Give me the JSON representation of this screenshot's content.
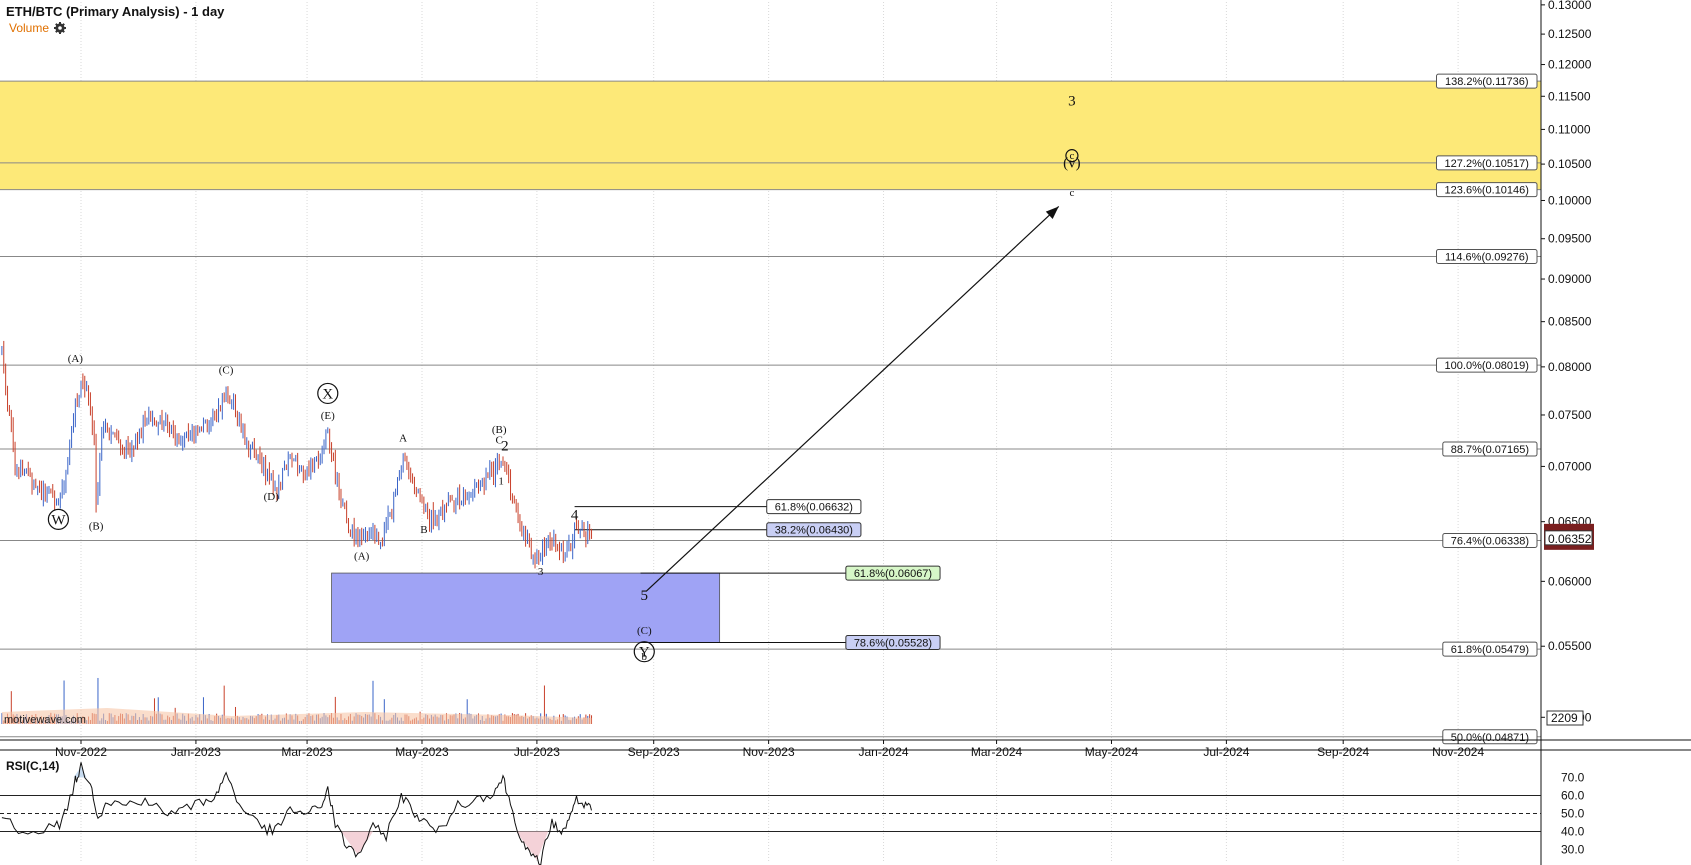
{
  "header": {
    "title": "ETH/BTC (Primary Analysis) - 1 day",
    "volume_label": "Volume",
    "watermark": "motivewave.com",
    "gear_icon": "gear-icon"
  },
  "colors": {
    "up": "#3a64c8",
    "down": "#c8402a",
    "target_zone": "#fde978",
    "support_zone": "#9fa3f5",
    "fib_green": "#d7f7c8",
    "fib_blue": "#c9cff5",
    "volume_area": "#f7c7a8",
    "rsi_fill": "#f4d2d8",
    "price_tag": "#7a1f1f",
    "wave3_red": "#e31e1e"
  },
  "chart_data": {
    "type": "candlestick",
    "title": "ETH/BTC (Primary Analysis) - 1 day",
    "y_axis": {
      "ticks": [
        "0.05000",
        "0.05500",
        "0.06000",
        "0.06500",
        "0.07000",
        "0.07500",
        "0.08000",
        "0.08500",
        "0.09000",
        "0.09500",
        "0.10000",
        "0.10500",
        "0.11000",
        "0.11500",
        "0.12000",
        "0.12500",
        "0.13000"
      ],
      "range": [
        0.0485,
        0.1305
      ],
      "scale": "log"
    },
    "x_axis": {
      "ticks": [
        "Nov-2022",
        "Jan-2023",
        "Mar-2023",
        "May-2023",
        "Jul-2023",
        "Sep-2023",
        "Nov-2023",
        "Jan-2024",
        "Mar-2024",
        "May-2024",
        "Jul-2024",
        "Sep-2024",
        "Nov-2024"
      ],
      "range": [
        "2022-09-19",
        "2024-12-15"
      ]
    },
    "price_path": [
      [
        "2022-09-20",
        0.0818
      ],
      [
        "2022-09-27",
        0.07
      ],
      [
        "2022-10-05",
        0.069
      ],
      [
        "2022-10-12",
        0.0675
      ],
      [
        "2022-10-20",
        0.0668
      ],
      [
        "2022-10-25",
        0.07
      ],
      [
        "2022-10-29",
        0.076
      ],
      [
        "2022-11-01",
        0.0787
      ],
      [
        "2022-11-05",
        0.077
      ],
      [
        "2022-11-08",
        0.072
      ],
      [
        "2022-11-09",
        0.066
      ],
      [
        "2022-11-12",
        0.074
      ],
      [
        "2022-11-20",
        0.0725
      ],
      [
        "2022-11-28",
        0.071
      ],
      [
        "2022-12-05",
        0.0745
      ],
      [
        "2022-12-12",
        0.0745
      ],
      [
        "2022-12-20",
        0.0728
      ],
      [
        "2022-12-28",
        0.073
      ],
      [
        "2023-01-05",
        0.074
      ],
      [
        "2023-01-12",
        0.075
      ],
      [
        "2023-01-17",
        0.0778
      ],
      [
        "2023-01-22",
        0.0755
      ],
      [
        "2023-01-29",
        0.072
      ],
      [
        "2023-02-05",
        0.07
      ],
      [
        "2023-02-13",
        0.068
      ],
      [
        "2023-02-20",
        0.0705
      ],
      [
        "2023-02-28",
        0.0695
      ],
      [
        "2023-03-07",
        0.0705
      ],
      [
        "2023-03-12",
        0.0735
      ],
      [
        "2023-03-16",
        0.069
      ],
      [
        "2023-03-22",
        0.065
      ],
      [
        "2023-03-28",
        0.0635
      ],
      [
        "2023-04-05",
        0.064
      ],
      [
        "2023-04-10",
        0.063
      ],
      [
        "2023-04-16",
        0.067
      ],
      [
        "2023-04-22",
        0.071
      ],
      [
        "2023-04-27",
        0.068
      ],
      [
        "2023-05-02",
        0.066
      ],
      [
        "2023-05-08",
        0.065
      ],
      [
        "2023-05-15",
        0.0665
      ],
      [
        "2023-05-25",
        0.0675
      ],
      [
        "2023-06-03",
        0.0685
      ],
      [
        "2023-06-10",
        0.07
      ],
      [
        "2023-06-13",
        0.0705
      ],
      [
        "2023-06-17",
        0.068
      ],
      [
        "2023-06-22",
        0.065
      ],
      [
        "2023-06-28",
        0.0625
      ],
      [
        "2023-07-02",
        0.0617
      ],
      [
        "2023-07-08",
        0.0635
      ],
      [
        "2023-07-13",
        0.0625
      ],
      [
        "2023-07-18",
        0.0625
      ],
      [
        "2023-07-21",
        0.0642
      ],
      [
        "2023-07-25",
        0.064
      ],
      [
        "2023-07-30",
        0.0638
      ]
    ],
    "current_price": "0.06352",
    "fib_levels_right": [
      {
        "label": "138.2%(0.11736)",
        "value": 0.11736
      },
      {
        "label": "127.2%(0.10517)",
        "value": 0.10517
      },
      {
        "label": "123.6%(0.10146)",
        "value": 0.10146
      },
      {
        "label": "114.6%(0.09276)",
        "value": 0.09276
      },
      {
        "label": "100.0%(0.08019)",
        "value": 0.08019
      },
      {
        "label": "88.7%(0.07165)",
        "value": 0.07165
      },
      {
        "label": "76.4%(0.06338)",
        "value": 0.06338
      },
      {
        "label": "61.8%(0.05479)",
        "value": 0.05479
      },
      {
        "label": "50.0%(0.04871)",
        "value": 0.04871
      }
    ],
    "fib_levels_mid": [
      {
        "label": "61.8%(0.06632)",
        "value": 0.06632,
        "start": "2023-07-21",
        "end": "2023-10-31"
      },
      {
        "label": "38.2%(0.06430)",
        "value": 0.0643,
        "start": "2023-07-21",
        "end": "2023-10-31"
      },
      {
        "label": "61.8%(0.06067)",
        "value": 0.06067,
        "start": "2023-08-25",
        "end": "2023-12-12"
      },
      {
        "label": "78.6%(0.05528)",
        "value": 0.05528,
        "start": "2023-08-25",
        "end": "2023-12-12"
      }
    ],
    "zones": [
      {
        "name": "target",
        "from": 0.10146,
        "to": 0.11736,
        "start": "2022-09-19",
        "end": "2024-12-15"
      },
      {
        "name": "support",
        "from": 0.05528,
        "to": 0.06067,
        "start": "2023-03-14",
        "end": "2023-10-06"
      }
    ],
    "arrow": {
      "from": [
        "2023-08-28",
        0.0592
      ],
      "to": [
        "2024-04-03",
        0.0992
      ]
    },
    "wave_labels": [
      {
        "t": "(A)",
        "d": "2022-10-29",
        "v": 0.0805,
        "c": "#111"
      },
      {
        "t": "(B)",
        "d": "2022-11-09",
        "v": 0.0643,
        "c": "#111"
      },
      {
        "t": "(C)",
        "d": "2023-01-17",
        "v": 0.0793,
        "c": "#111"
      },
      {
        "t": "(D)",
        "d": "2023-02-10",
        "v": 0.0669,
        "c": "#111"
      },
      {
        "t": "(E)",
        "d": "2023-03-12",
        "v": 0.0746,
        "c": "#111"
      },
      {
        "t": "(A)",
        "d": "2023-03-30",
        "v": 0.0618,
        "c": "#111"
      },
      {
        "t": "A",
        "d": "2023-04-21",
        "v": 0.0724,
        "c": "#111"
      },
      {
        "t": "B",
        "d": "2023-05-02",
        "v": 0.064,
        "c": "#111"
      },
      {
        "t": "(B)",
        "d": "2023-06-11",
        "v": 0.0732,
        "c": "#111"
      },
      {
        "t": "C",
        "d": "2023-06-11",
        "v": 0.0722,
        "c": "#111"
      },
      {
        "t": "1",
        "d": "2023-06-12",
        "v": 0.0683,
        "c": "#111"
      },
      {
        "t": "3",
        "d": "2023-07-03",
        "v": 0.0605,
        "c": "#111"
      },
      {
        "t": "b",
        "d": "2023-08-27",
        "v": 0.054,
        "c": "#111"
      },
      {
        "t": "c",
        "d": "2024-04-10",
        "v": 0.1006,
        "c": "#111"
      }
    ],
    "wave_labels_big": [
      {
        "t": "2",
        "d": "2023-06-14",
        "v": 0.0715,
        "c": "#111"
      },
      {
        "t": "4",
        "d": "2023-07-21",
        "v": 0.0652,
        "c": "#111"
      },
      {
        "t": "5",
        "d": "2023-08-27",
        "v": 0.0585,
        "c": "#111"
      },
      {
        "t": "3",
        "d": "2024-04-10",
        "v": 0.1136,
        "c": "#e31e1e"
      },
      {
        "t": "(v)",
        "d": "2024-04-10",
        "v": 0.1045,
        "c": "#111"
      }
    ],
    "wave_labels_small": [
      {
        "t": "(C)",
        "d": "2023-08-27",
        "v": 0.0559,
        "c": "#111"
      }
    ],
    "wave_circles": [
      {
        "t": "W",
        "d": "2022-10-20",
        "v": 0.0652
      },
      {
        "t": "X",
        "d": "2023-03-12",
        "v": 0.0772
      },
      {
        "t": "Y",
        "d": "2023-08-27",
        "v": 0.0546
      },
      {
        "t": "c",
        "d": "2024-04-10",
        "v": 0.1062
      }
    ],
    "volume": {
      "label": "2209",
      "shown_by": "orange-red and blue bars with shaded moving average area"
    },
    "rsi": {
      "label": "RSI(C,14)",
      "ticks": [
        "70.0",
        "60.0",
        "50.0",
        "40.0",
        "30.0"
      ],
      "range": [
        23,
        82
      ],
      "levels": [
        60,
        50,
        40
      ],
      "series": [
        [
          "2022-09-20",
          48
        ],
        [
          "2022-10-01",
          40
        ],
        [
          "2022-10-15",
          42
        ],
        [
          "2022-10-22",
          45
        ],
        [
          "2022-10-29",
          68
        ],
        [
          "2022-11-01",
          76
        ],
        [
          "2022-11-06",
          68
        ],
        [
          "2022-11-10",
          48
        ],
        [
          "2022-11-15",
          56
        ],
        [
          "2022-11-25",
          55
        ],
        [
          "2022-12-05",
          58
        ],
        [
          "2022-12-15",
          50
        ],
        [
          "2022-12-25",
          52
        ],
        [
          "2023-01-05",
          57
        ],
        [
          "2023-01-12",
          60
        ],
        [
          "2023-01-17",
          73
        ],
        [
          "2023-01-24",
          55
        ],
        [
          "2023-02-05",
          42
        ],
        [
          "2023-02-12",
          40
        ],
        [
          "2023-02-20",
          52
        ],
        [
          "2023-03-01",
          50
        ],
        [
          "2023-03-08",
          53
        ],
        [
          "2023-03-12",
          64
        ],
        [
          "2023-03-16",
          44
        ],
        [
          "2023-03-22",
          32
        ],
        [
          "2023-03-28",
          27
        ],
        [
          "2023-04-05",
          42
        ],
        [
          "2023-04-12",
          38
        ],
        [
          "2023-04-20",
          60
        ],
        [
          "2023-04-26",
          52
        ],
        [
          "2023-05-02",
          45
        ],
        [
          "2023-05-10",
          40
        ],
        [
          "2023-05-20",
          55
        ],
        [
          "2023-05-30",
          58
        ],
        [
          "2023-06-08",
          62
        ],
        [
          "2023-06-13",
          70
        ],
        [
          "2023-06-17",
          55
        ],
        [
          "2023-06-23",
          35
        ],
        [
          "2023-06-28",
          25
        ],
        [
          "2023-07-03",
          24
        ],
        [
          "2023-07-09",
          45
        ],
        [
          "2023-07-14",
          40
        ],
        [
          "2023-07-18",
          45
        ],
        [
          "2023-07-21",
          58
        ],
        [
          "2023-07-26",
          54
        ],
        [
          "2023-07-30",
          52
        ]
      ]
    }
  }
}
